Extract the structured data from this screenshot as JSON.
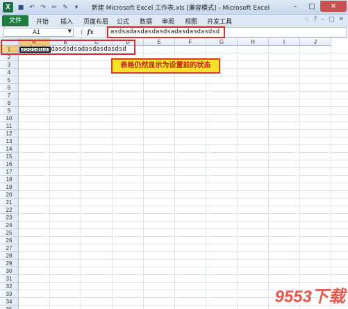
{
  "titlebar": {
    "logo": "X",
    "title": "新建 Microsoft Excel 工作表.xls  [兼容模式] - Microsoft Excel",
    "qat_icons": [
      "save-icon",
      "undo-icon",
      "redo-icon",
      "cut-icon",
      "paint-icon",
      "customize-icon"
    ],
    "controls": {
      "minimize": "–",
      "maximize": "□",
      "close": "✕"
    }
  },
  "ribbon": {
    "file_tab": "文件",
    "tabs": [
      "开始",
      "插入",
      "页面布局",
      "公式",
      "数据",
      "审阅",
      "视图",
      "开发工具"
    ],
    "right_controls": [
      "♢",
      "?",
      "–",
      "□",
      "✕"
    ]
  },
  "formula_bar": {
    "name_box": "A1",
    "fx": "fx",
    "formula": "asdsadasdasdasdsadasdasdasdsd"
  },
  "grid": {
    "columns": [
      "A",
      "B",
      "C",
      "D",
      "E",
      "F",
      "G",
      "H",
      "I",
      "J"
    ],
    "active_column": "A",
    "rows": [
      "1",
      "2",
      "3",
      "4",
      "5",
      "6",
      "7",
      "8",
      "9",
      "10",
      "11",
      "12",
      "13",
      "14",
      "15",
      "16",
      "17",
      "18",
      "19",
      "20",
      "21",
      "22",
      "23",
      "24",
      "25",
      "26",
      "27",
      "28",
      "29",
      "30",
      "31",
      "32",
      "33",
      "34",
      "35"
    ],
    "active_row": "1",
    "cell_a1_text": "asdsadasdasdsdsadasdasdasdsd"
  },
  "callout": {
    "text": "表格仍然显示为设置前的状态"
  },
  "watermark": {
    "text": "9553下载"
  },
  "colors": {
    "highlight": "#d62d2d",
    "callout_bg": "#f6e22b",
    "file_tab": "#1f7a3e",
    "active_header": "#f1c36b"
  }
}
